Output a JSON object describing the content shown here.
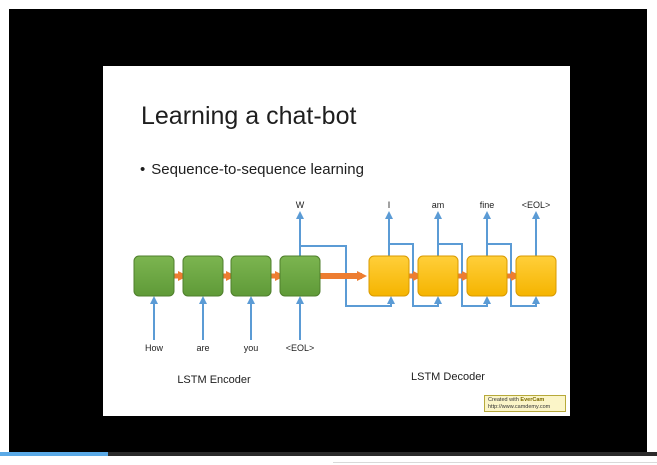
{
  "slide": {
    "title": "Learning a chat-bot",
    "bullet": "Sequence-to-sequence learning",
    "bullet_symbol": "•"
  },
  "diagram": {
    "encoder_label": "LSTM Encoder",
    "decoder_label": "LSTM Decoder",
    "encoder_inputs": [
      "How",
      "are",
      "you",
      "<EOL>"
    ],
    "encoder_output": "W",
    "decoder_outputs": [
      "I",
      "am",
      "fine",
      "<EOL>"
    ],
    "colors": {
      "encoder_cell": "#70a845",
      "decoder_cell": "#ffc000",
      "recurrent_arrow": "#ed7d31",
      "io_arrow": "#5b9bd5"
    }
  },
  "watermark": {
    "line1_prefix": "Created with",
    "brand": "EverCam",
    "url": "http://www.camdemy.com"
  },
  "player": {
    "progress": 0.165
  }
}
